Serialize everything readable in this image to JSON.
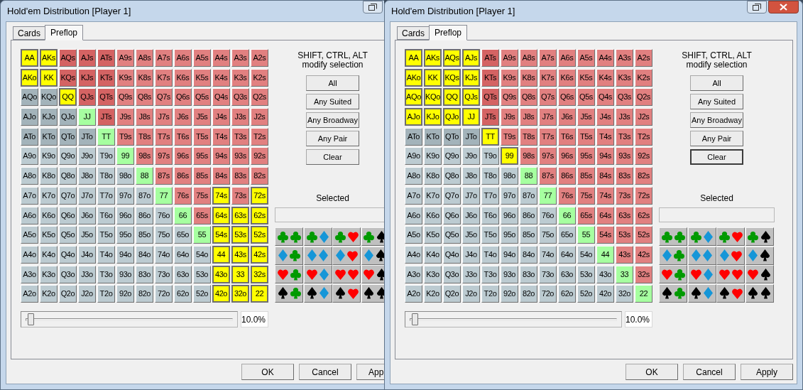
{
  "windows": [
    {
      "title": "Hold'em Distribution [Player 1]",
      "title_buttons": [
        {
          "kind": "restore"
        }
      ],
      "tabs": [
        {
          "label": "Cards",
          "selected": false
        },
        {
          "label": "Preflop",
          "selected": true
        }
      ],
      "grid": [
        [
          {
            "label": "AA",
            "selected": true
          },
          {
            "label": "AKs",
            "selected": true
          },
          {
            "label": "AQs",
            "selected": false
          },
          {
            "label": "AJs",
            "selected": false
          },
          {
            "label": "ATs",
            "selected": false
          },
          {
            "label": "A9s",
            "selected": false
          },
          {
            "label": "A8s",
            "selected": false
          },
          {
            "label": "A7s",
            "selected": false
          },
          {
            "label": "A6s",
            "selected": false
          },
          {
            "label": "A5s",
            "selected": false
          },
          {
            "label": "A4s",
            "selected": false
          },
          {
            "label": "A3s",
            "selected": false
          },
          {
            "label": "A2s",
            "selected": false
          }
        ],
        [
          {
            "label": "AKo",
            "selected": true
          },
          {
            "label": "KK",
            "selected": true
          },
          {
            "label": "KQs",
            "selected": false
          },
          {
            "label": "KJs",
            "selected": false
          },
          {
            "label": "KTs",
            "selected": false
          },
          {
            "label": "K9s",
            "selected": false
          },
          {
            "label": "K8s",
            "selected": false
          },
          {
            "label": "K7s",
            "selected": false
          },
          {
            "label": "K6s",
            "selected": false
          },
          {
            "label": "K5s",
            "selected": false
          },
          {
            "label": "K4s",
            "selected": false
          },
          {
            "label": "K3s",
            "selected": false
          },
          {
            "label": "K2s",
            "selected": false
          }
        ],
        [
          {
            "label": "AQo",
            "selected": false
          },
          {
            "label": "KQo",
            "selected": false
          },
          {
            "label": "QQ",
            "selected": true
          },
          {
            "label": "QJs",
            "selected": false
          },
          {
            "label": "QTs",
            "selected": false
          },
          {
            "label": "Q9s",
            "selected": false
          },
          {
            "label": "Q8s",
            "selected": false
          },
          {
            "label": "Q7s",
            "selected": false
          },
          {
            "label": "Q6s",
            "selected": false
          },
          {
            "label": "Q5s",
            "selected": false
          },
          {
            "label": "Q4s",
            "selected": false
          },
          {
            "label": "Q3s",
            "selected": false
          },
          {
            "label": "Q2s",
            "selected": false
          }
        ],
        [
          {
            "label": "AJo",
            "selected": false
          },
          {
            "label": "KJo",
            "selected": false
          },
          {
            "label": "QJo",
            "selected": false
          },
          {
            "label": "JJ",
            "selected": false
          },
          {
            "label": "JTs",
            "selected": false
          },
          {
            "label": "J9s",
            "selected": false
          },
          {
            "label": "J8s",
            "selected": false
          },
          {
            "label": "J7s",
            "selected": false
          },
          {
            "label": "J6s",
            "selected": false
          },
          {
            "label": "J5s",
            "selected": false
          },
          {
            "label": "J4s",
            "selected": false
          },
          {
            "label": "J3s",
            "selected": false
          },
          {
            "label": "J2s",
            "selected": false
          }
        ],
        [
          {
            "label": "ATo",
            "selected": false
          },
          {
            "label": "KTo",
            "selected": false
          },
          {
            "label": "QTo",
            "selected": false
          },
          {
            "label": "JTo",
            "selected": false
          },
          {
            "label": "TT",
            "selected": false
          },
          {
            "label": "T9s",
            "selected": false
          },
          {
            "label": "T8s",
            "selected": false
          },
          {
            "label": "T7s",
            "selected": false
          },
          {
            "label": "T6s",
            "selected": false
          },
          {
            "label": "T5s",
            "selected": false
          },
          {
            "label": "T4s",
            "selected": false
          },
          {
            "label": "T3s",
            "selected": false
          },
          {
            "label": "T2s",
            "selected": false
          }
        ],
        [
          {
            "label": "A9o",
            "selected": false
          },
          {
            "label": "K9o",
            "selected": false
          },
          {
            "label": "Q9o",
            "selected": false
          },
          {
            "label": "J9o",
            "selected": false
          },
          {
            "label": "T9o",
            "selected": false
          },
          {
            "label": "99",
            "selected": false
          },
          {
            "label": "98s",
            "selected": false
          },
          {
            "label": "97s",
            "selected": false
          },
          {
            "label": "96s",
            "selected": false
          },
          {
            "label": "95s",
            "selected": false
          },
          {
            "label": "94s",
            "selected": false
          },
          {
            "label": "93s",
            "selected": false
          },
          {
            "label": "92s",
            "selected": false
          }
        ],
        [
          {
            "label": "A8o",
            "selected": false
          },
          {
            "label": "K8o",
            "selected": false
          },
          {
            "label": "Q8o",
            "selected": false
          },
          {
            "label": "J8o",
            "selected": false
          },
          {
            "label": "T8o",
            "selected": false
          },
          {
            "label": "98o",
            "selected": false
          },
          {
            "label": "88",
            "selected": false
          },
          {
            "label": "87s",
            "selected": false
          },
          {
            "label": "86s",
            "selected": false
          },
          {
            "label": "85s",
            "selected": false
          },
          {
            "label": "84s",
            "selected": false
          },
          {
            "label": "83s",
            "selected": false
          },
          {
            "label": "82s",
            "selected": false
          }
        ],
        [
          {
            "label": "A7o",
            "selected": false
          },
          {
            "label": "K7o",
            "selected": false
          },
          {
            "label": "Q7o",
            "selected": false
          },
          {
            "label": "J7o",
            "selected": false
          },
          {
            "label": "T7o",
            "selected": false
          },
          {
            "label": "97o",
            "selected": false
          },
          {
            "label": "87o",
            "selected": false
          },
          {
            "label": "77",
            "selected": false
          },
          {
            "label": "76s",
            "selected": false
          },
          {
            "label": "75s",
            "selected": false
          },
          {
            "label": "74s",
            "selected": true
          },
          {
            "label": "73s",
            "selected": false
          },
          {
            "label": "72s",
            "selected": true
          }
        ],
        [
          {
            "label": "A6o",
            "selected": false
          },
          {
            "label": "K6o",
            "selected": false
          },
          {
            "label": "Q6o",
            "selected": false
          },
          {
            "label": "J6o",
            "selected": false
          },
          {
            "label": "T6o",
            "selected": false
          },
          {
            "label": "96o",
            "selected": false
          },
          {
            "label": "86o",
            "selected": false
          },
          {
            "label": "76o",
            "selected": false
          },
          {
            "label": "66",
            "selected": false
          },
          {
            "label": "65s",
            "selected": false
          },
          {
            "label": "64s",
            "selected": true
          },
          {
            "label": "63s",
            "selected": true
          },
          {
            "label": "62s",
            "selected": true
          }
        ],
        [
          {
            "label": "A5o",
            "selected": false
          },
          {
            "label": "K5o",
            "selected": false
          },
          {
            "label": "Q5o",
            "selected": false
          },
          {
            "label": "J5o",
            "selected": false
          },
          {
            "label": "T5o",
            "selected": false
          },
          {
            "label": "95o",
            "selected": false
          },
          {
            "label": "85o",
            "selected": false
          },
          {
            "label": "75o",
            "selected": false
          },
          {
            "label": "65o",
            "selected": false
          },
          {
            "label": "55",
            "selected": false
          },
          {
            "label": "54s",
            "selected": true
          },
          {
            "label": "53s",
            "selected": true
          },
          {
            "label": "52s",
            "selected": true
          }
        ],
        [
          {
            "label": "A4o",
            "selected": false
          },
          {
            "label": "K4o",
            "selected": false
          },
          {
            "label": "Q4o",
            "selected": false
          },
          {
            "label": "J4o",
            "selected": false
          },
          {
            "label": "T4o",
            "selected": false
          },
          {
            "label": "94o",
            "selected": false
          },
          {
            "label": "84o",
            "selected": false
          },
          {
            "label": "74o",
            "selected": false
          },
          {
            "label": "64o",
            "selected": false
          },
          {
            "label": "54o",
            "selected": false
          },
          {
            "label": "44",
            "selected": true
          },
          {
            "label": "43s",
            "selected": true
          },
          {
            "label": "42s",
            "selected": true
          }
        ],
        [
          {
            "label": "A3o",
            "selected": false
          },
          {
            "label": "K3o",
            "selected": false
          },
          {
            "label": "Q3o",
            "selected": false
          },
          {
            "label": "J3o",
            "selected": false
          },
          {
            "label": "T3o",
            "selected": false
          },
          {
            "label": "93o",
            "selected": false
          },
          {
            "label": "83o",
            "selected": false
          },
          {
            "label": "73o",
            "selected": false
          },
          {
            "label": "63o",
            "selected": false
          },
          {
            "label": "53o",
            "selected": false
          },
          {
            "label": "43o",
            "selected": true
          },
          {
            "label": "33",
            "selected": true
          },
          {
            "label": "32s",
            "selected": true
          }
        ],
        [
          {
            "label": "A2o",
            "selected": false
          },
          {
            "label": "K2o",
            "selected": false
          },
          {
            "label": "Q2o",
            "selected": false
          },
          {
            "label": "J2o",
            "selected": false
          },
          {
            "label": "T2o",
            "selected": false
          },
          {
            "label": "92o",
            "selected": false
          },
          {
            "label": "82o",
            "selected": false
          },
          {
            "label": "72o",
            "selected": false
          },
          {
            "label": "62o",
            "selected": false
          },
          {
            "label": "52o",
            "selected": false
          },
          {
            "label": "42o",
            "selected": true
          },
          {
            "label": "32o",
            "selected": true
          },
          {
            "label": "22",
            "selected": true
          }
        ]
      ],
      "hint_lines": [
        "SHIFT, CTRL, ALT",
        "modify selection"
      ],
      "buttons": [
        {
          "label": "All",
          "focused": false
        },
        {
          "label": "Any Suited",
          "focused": false
        },
        {
          "label": "Any Broadway",
          "focused": false
        },
        {
          "label": "Any Pair",
          "focused": false
        },
        {
          "label": "Clear",
          "focused": false
        }
      ],
      "selected_label": "Selected",
      "slider": {
        "level": 0.02,
        "reading": "10.0%"
      },
      "dialog_buttons": [
        {
          "label": "OK"
        },
        {
          "label": "Cancel"
        },
        {
          "label": "App"
        }
      ]
    },
    {
      "title": "Hold'em Distribution [Player 1]",
      "title_buttons": [
        {
          "kind": "restore"
        },
        {
          "kind": "close"
        }
      ],
      "tabs": [
        {
          "label": "Cards",
          "selected": false
        },
        {
          "label": "Preflop",
          "selected": true
        }
      ],
      "grid": [
        [
          {
            "label": "AA",
            "selected": true
          },
          {
            "label": "AKs",
            "selected": true
          },
          {
            "label": "AQs",
            "selected": true
          },
          {
            "label": "AJs",
            "selected": true
          },
          {
            "label": "ATs",
            "selected": false
          },
          {
            "label": "A9s",
            "selected": false
          },
          {
            "label": "A8s",
            "selected": false
          },
          {
            "label": "A7s",
            "selected": false
          },
          {
            "label": "A6s",
            "selected": false
          },
          {
            "label": "A5s",
            "selected": false
          },
          {
            "label": "A4s",
            "selected": false
          },
          {
            "label": "A3s",
            "selected": false
          },
          {
            "label": "A2s",
            "selected": false
          }
        ],
        [
          {
            "label": "AKo",
            "selected": true
          },
          {
            "label": "KK",
            "selected": true
          },
          {
            "label": "KQs",
            "selected": true
          },
          {
            "label": "KJs",
            "selected": true
          },
          {
            "label": "KTs",
            "selected": false
          },
          {
            "label": "K9s",
            "selected": false
          },
          {
            "label": "K8s",
            "selected": false
          },
          {
            "label": "K7s",
            "selected": false
          },
          {
            "label": "K6s",
            "selected": false
          },
          {
            "label": "K5s",
            "selected": false
          },
          {
            "label": "K4s",
            "selected": false
          },
          {
            "label": "K3s",
            "selected": false
          },
          {
            "label": "K2s",
            "selected": false
          }
        ],
        [
          {
            "label": "AQo",
            "selected": true
          },
          {
            "label": "KQo",
            "selected": true
          },
          {
            "label": "QQ",
            "selected": true
          },
          {
            "label": "QJs",
            "selected": true
          },
          {
            "label": "QTs",
            "selected": false
          },
          {
            "label": "Q9s",
            "selected": false
          },
          {
            "label": "Q8s",
            "selected": false
          },
          {
            "label": "Q7s",
            "selected": false
          },
          {
            "label": "Q6s",
            "selected": false
          },
          {
            "label": "Q5s",
            "selected": false
          },
          {
            "label": "Q4s",
            "selected": false
          },
          {
            "label": "Q3s",
            "selected": false
          },
          {
            "label": "Q2s",
            "selected": false
          }
        ],
        [
          {
            "label": "AJo",
            "selected": true
          },
          {
            "label": "KJo",
            "selected": true
          },
          {
            "label": "QJo",
            "selected": true
          },
          {
            "label": "JJ",
            "selected": true
          },
          {
            "label": "JTs",
            "selected": false
          },
          {
            "label": "J9s",
            "selected": false
          },
          {
            "label": "J8s",
            "selected": false
          },
          {
            "label": "J7s",
            "selected": false
          },
          {
            "label": "J6s",
            "selected": false
          },
          {
            "label": "J5s",
            "selected": false
          },
          {
            "label": "J4s",
            "selected": false
          },
          {
            "label": "J3s",
            "selected": false
          },
          {
            "label": "J2s",
            "selected": false
          }
        ],
        [
          {
            "label": "ATo",
            "selected": false
          },
          {
            "label": "KTo",
            "selected": false
          },
          {
            "label": "QTo",
            "selected": false
          },
          {
            "label": "JTo",
            "selected": false
          },
          {
            "label": "TT",
            "selected": true
          },
          {
            "label": "T9s",
            "selected": false
          },
          {
            "label": "T8s",
            "selected": false
          },
          {
            "label": "T7s",
            "selected": false
          },
          {
            "label": "T6s",
            "selected": false
          },
          {
            "label": "T5s",
            "selected": false
          },
          {
            "label": "T4s",
            "selected": false
          },
          {
            "label": "T3s",
            "selected": false
          },
          {
            "label": "T2s",
            "selected": false
          }
        ],
        [
          {
            "label": "A9o",
            "selected": false
          },
          {
            "label": "K9o",
            "selected": false
          },
          {
            "label": "Q9o",
            "selected": false
          },
          {
            "label": "J9o",
            "selected": false
          },
          {
            "label": "T9o",
            "selected": false
          },
          {
            "label": "99",
            "selected": true
          },
          {
            "label": "98s",
            "selected": false
          },
          {
            "label": "97s",
            "selected": false
          },
          {
            "label": "96s",
            "selected": false
          },
          {
            "label": "95s",
            "selected": false
          },
          {
            "label": "94s",
            "selected": false
          },
          {
            "label": "93s",
            "selected": false
          },
          {
            "label": "92s",
            "selected": false
          }
        ],
        [
          {
            "label": "A8o",
            "selected": false
          },
          {
            "label": "K8o",
            "selected": false
          },
          {
            "label": "Q8o",
            "selected": false
          },
          {
            "label": "J8o",
            "selected": false
          },
          {
            "label": "T8o",
            "selected": false
          },
          {
            "label": "98o",
            "selected": false
          },
          {
            "label": "88",
            "selected": false
          },
          {
            "label": "87s",
            "selected": false
          },
          {
            "label": "86s",
            "selected": false
          },
          {
            "label": "85s",
            "selected": false
          },
          {
            "label": "84s",
            "selected": false
          },
          {
            "label": "83s",
            "selected": false
          },
          {
            "label": "82s",
            "selected": false
          }
        ],
        [
          {
            "label": "A7o",
            "selected": false
          },
          {
            "label": "K7o",
            "selected": false
          },
          {
            "label": "Q7o",
            "selected": false
          },
          {
            "label": "J7o",
            "selected": false
          },
          {
            "label": "T7o",
            "selected": false
          },
          {
            "label": "97o",
            "selected": false
          },
          {
            "label": "87o",
            "selected": false
          },
          {
            "label": "77",
            "selected": false
          },
          {
            "label": "76s",
            "selected": false
          },
          {
            "label": "75s",
            "selected": false
          },
          {
            "label": "74s",
            "selected": false
          },
          {
            "label": "73s",
            "selected": false
          },
          {
            "label": "72s",
            "selected": false
          }
        ],
        [
          {
            "label": "A6o",
            "selected": false
          },
          {
            "label": "K6o",
            "selected": false
          },
          {
            "label": "Q6o",
            "selected": false
          },
          {
            "label": "J6o",
            "selected": false
          },
          {
            "label": "T6o",
            "selected": false
          },
          {
            "label": "96o",
            "selected": false
          },
          {
            "label": "86o",
            "selected": false
          },
          {
            "label": "76o",
            "selected": false
          },
          {
            "label": "66",
            "selected": false
          },
          {
            "label": "65s",
            "selected": false
          },
          {
            "label": "64s",
            "selected": false
          },
          {
            "label": "63s",
            "selected": false
          },
          {
            "label": "62s",
            "selected": false
          }
        ],
        [
          {
            "label": "A5o",
            "selected": false
          },
          {
            "label": "K5o",
            "selected": false
          },
          {
            "label": "Q5o",
            "selected": false
          },
          {
            "label": "J5o",
            "selected": false
          },
          {
            "label": "T5o",
            "selected": false
          },
          {
            "label": "95o",
            "selected": false
          },
          {
            "label": "85o",
            "selected": false
          },
          {
            "label": "75o",
            "selected": false
          },
          {
            "label": "65o",
            "selected": false
          },
          {
            "label": "55",
            "selected": false
          },
          {
            "label": "54s",
            "selected": false
          },
          {
            "label": "53s",
            "selected": false
          },
          {
            "label": "52s",
            "selected": false
          }
        ],
        [
          {
            "label": "A4o",
            "selected": false
          },
          {
            "label": "K4o",
            "selected": false
          },
          {
            "label": "Q4o",
            "selected": false
          },
          {
            "label": "J4o",
            "selected": false
          },
          {
            "label": "T4o",
            "selected": false
          },
          {
            "label": "94o",
            "selected": false
          },
          {
            "label": "84o",
            "selected": false
          },
          {
            "label": "74o",
            "selected": false
          },
          {
            "label": "64o",
            "selected": false
          },
          {
            "label": "54o",
            "selected": false
          },
          {
            "label": "44",
            "selected": false
          },
          {
            "label": "43s",
            "selected": false
          },
          {
            "label": "42s",
            "selected": false
          }
        ],
        [
          {
            "label": "A3o",
            "selected": false
          },
          {
            "label": "K3o",
            "selected": false
          },
          {
            "label": "Q3o",
            "selected": false
          },
          {
            "label": "J3o",
            "selected": false
          },
          {
            "label": "T3o",
            "selected": false
          },
          {
            "label": "93o",
            "selected": false
          },
          {
            "label": "83o",
            "selected": false
          },
          {
            "label": "73o",
            "selected": false
          },
          {
            "label": "63o",
            "selected": false
          },
          {
            "label": "53o",
            "selected": false
          },
          {
            "label": "43o",
            "selected": false
          },
          {
            "label": "33",
            "selected": false
          },
          {
            "label": "32s",
            "selected": false
          }
        ],
        [
          {
            "label": "A2o",
            "selected": false
          },
          {
            "label": "K2o",
            "selected": false
          },
          {
            "label": "Q2o",
            "selected": false
          },
          {
            "label": "J2o",
            "selected": false
          },
          {
            "label": "T2o",
            "selected": false
          },
          {
            "label": "92o",
            "selected": false
          },
          {
            "label": "82o",
            "selected": false
          },
          {
            "label": "72o",
            "selected": false
          },
          {
            "label": "62o",
            "selected": false
          },
          {
            "label": "52o",
            "selected": false
          },
          {
            "label": "42o",
            "selected": false
          },
          {
            "label": "32o",
            "selected": false
          },
          {
            "label": "22",
            "selected": false
          }
        ]
      ],
      "hint_lines": [
        "SHIFT, CTRL, ALT",
        "modify selection"
      ],
      "buttons": [
        {
          "label": "All",
          "focused": false
        },
        {
          "label": "Any Suited",
          "focused": false
        },
        {
          "label": "Any Broadway",
          "focused": false
        },
        {
          "label": "Any Pair",
          "focused": false
        },
        {
          "label": "Clear",
          "focused": true
        }
      ],
      "selected_label": "Selected",
      "slider": {
        "level": 0.02,
        "reading": "10.0%"
      },
      "dialog_buttons": [
        {
          "label": "OK"
        },
        {
          "label": "Cancel"
        },
        {
          "label": "Apply"
        }
      ]
    }
  ]
}
